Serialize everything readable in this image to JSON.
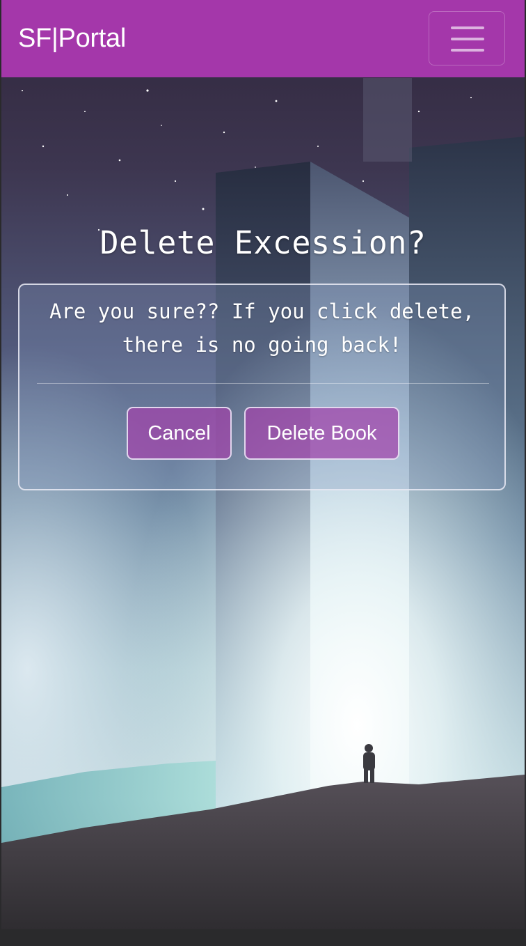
{
  "navbar": {
    "brand": "SF|Portal",
    "menu_toggle": "menu-icon",
    "background_color": "#a437aa"
  },
  "dialog": {
    "title": "Delete Excession?",
    "message": "Are you sure?? If you click delete, there is no going back!",
    "cancel_label": "Cancel",
    "delete_label": "Delete Book",
    "button_color": "#a242aa"
  }
}
